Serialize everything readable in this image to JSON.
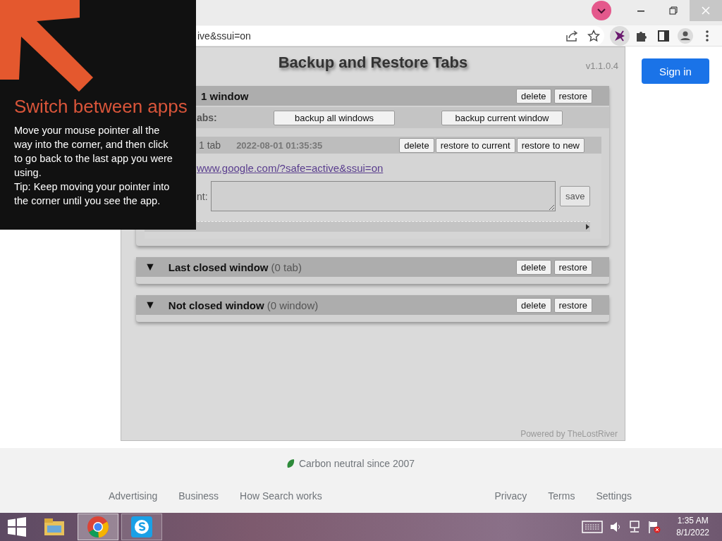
{
  "browser": {
    "address": "ive&ssui=on",
    "sign_in": "Sign in"
  },
  "extension_popup": {
    "title": "Backup and Restore Tabs",
    "version": "v1.1.0.4",
    "sections": [
      {
        "kind": "current",
        "heading": "1 window",
        "buttons": [
          "delete",
          "restore"
        ],
        "backup_label": "abs:",
        "backup_buttons": [
          "backup all windows",
          "backup current window"
        ],
        "tab_groups": [
          {
            "count": "1 tab",
            "timestamp": "2022-08-01 01:35:35",
            "buttons": [
              "delete",
              "restore to current",
              "restore to new"
            ],
            "link": "www.google.com/?safe=active&ssui=on",
            "comment_label": "nt:",
            "save": "save"
          }
        ]
      },
      {
        "kind": "closed",
        "toggle": "▼",
        "heading": "Last closed window",
        "count": "(0 tab)",
        "buttons": [
          "delete",
          "restore"
        ]
      },
      {
        "kind": "closed",
        "toggle": "▼",
        "heading": "Not closed window",
        "count": "(0 window)",
        "buttons": [
          "delete",
          "restore"
        ]
      }
    ],
    "footer": "Powered by TheLostRiver"
  },
  "page_footer": {
    "carbon": "Carbon neutral since 2007",
    "links_left": [
      "Advertising",
      "Business",
      "How Search works"
    ],
    "links_right": [
      "Privacy",
      "Terms",
      "Settings"
    ]
  },
  "charm_hint": {
    "title": "Switch between apps",
    "paragraphs": [
      "Move your mouse pointer all the way into the corner, and then click to go back to the last app you were using.",
      "Tip: Keep moving your pointer into the corner until you see the app."
    ]
  },
  "taskbar": {
    "apps": [
      {
        "kind": "explorer",
        "selected": false,
        "running": false
      },
      {
        "kind": "chrome",
        "selected": true,
        "running": true
      },
      {
        "kind": "skype",
        "selected": false,
        "running": true
      }
    ],
    "time": "1:35 AM",
    "date": "8/1/2022"
  }
}
